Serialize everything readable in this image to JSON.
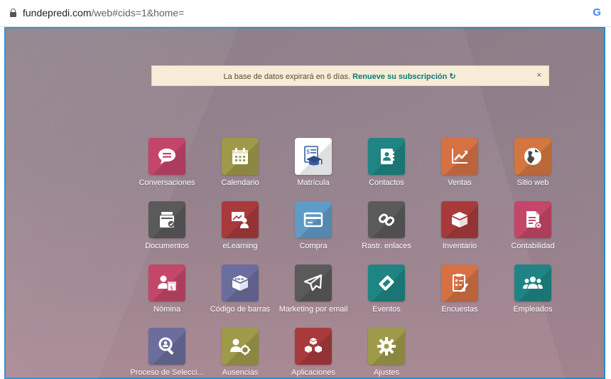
{
  "browser": {
    "url_host": "fundepredi.com",
    "url_path": "/web#cids=1&home=",
    "account_icon": "google-g-icon",
    "account_letter": "G"
  },
  "banner": {
    "message": "La base de datos expirará en 6 días.",
    "link": "Renueve su subscripción",
    "refresh_icon": "↻",
    "close": "×"
  },
  "apps": [
    {
      "label": "Conversaciones",
      "icon": "chat-icon",
      "color": "#c4446a"
    },
    {
      "label": "Calendario",
      "icon": "calendar-icon",
      "color": "#9e9a4a"
    },
    {
      "label": "Matrícula",
      "icon": "enrollment-icon",
      "color": "#ffffff"
    },
    {
      "label": "Contactos",
      "icon": "contacts-icon",
      "color": "#1f8584"
    },
    {
      "label": "Ventas",
      "icon": "sales-chart-icon",
      "color": "#d57143"
    },
    {
      "label": "Sitio web",
      "icon": "globe-icon",
      "color": "#d4763f"
    },
    {
      "label": "Documentos",
      "icon": "documents-icon",
      "color": "#5a5a5a"
    },
    {
      "label": "eLearning",
      "icon": "elearning-icon",
      "color": "#a83a3c"
    },
    {
      "label": "Compra",
      "icon": "purchase-card-icon",
      "color": "#5f9bc7"
    },
    {
      "label": "Rastr. enlaces",
      "icon": "link-tracker-icon",
      "color": "#5a5a5a"
    },
    {
      "label": "Inventario",
      "icon": "inventory-box-icon",
      "color": "#a83a3c"
    },
    {
      "label": "Contabilidad",
      "icon": "accounting-icon",
      "color": "#c44669"
    },
    {
      "label": "Nómina",
      "icon": "payroll-icon",
      "color": "#c44669"
    },
    {
      "label": "Código de barras",
      "icon": "barcode-box-icon",
      "color": "#6b6d9d"
    },
    {
      "label": "Marketing por email",
      "icon": "paper-plane-icon",
      "color": "#5a5a5a"
    },
    {
      "label": "Eventos",
      "icon": "ticket-icon",
      "color": "#1f8584"
    },
    {
      "label": "Encuestas",
      "icon": "survey-icon",
      "color": "#d57143"
    },
    {
      "label": "Empleados",
      "icon": "employees-icon",
      "color": "#1f8584"
    },
    {
      "label": "Proceso de Selecci...",
      "icon": "recruitment-search-icon",
      "color": "#6b6d9d"
    },
    {
      "label": "Ausencias",
      "icon": "time-off-icon",
      "color": "#9e9a4a"
    },
    {
      "label": "Aplicaciones",
      "icon": "apps-cubes-icon",
      "color": "#a83a3c"
    },
    {
      "label": "Ajustes",
      "icon": "settings-gear-icon",
      "color": "#9e9a4a"
    }
  ]
}
